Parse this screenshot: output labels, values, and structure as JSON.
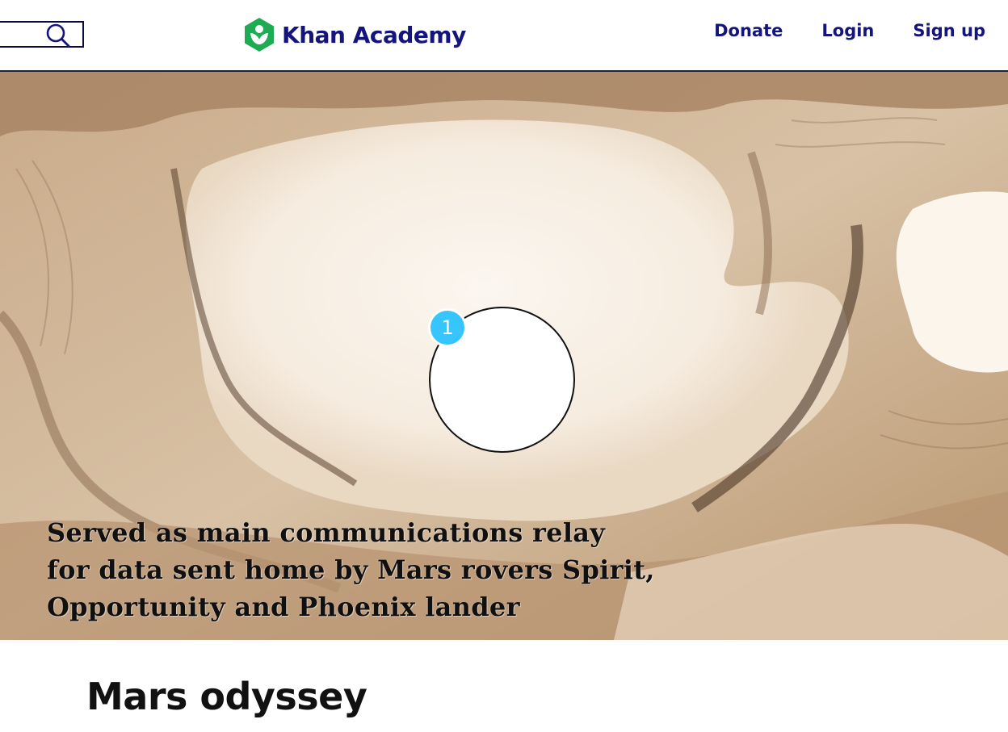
{
  "header": {
    "logo_text": "Khan Academy",
    "nav": {
      "donate": "Donate",
      "login": "Login",
      "signup": "Sign up"
    }
  },
  "video": {
    "caption_lines": [
      "Served as main communications relay",
      "for data sent home by Mars rovers Spirit,",
      "Opportunity and Phoenix lander"
    ],
    "badge": "1"
  },
  "page": {
    "title": "Mars odyssey"
  },
  "colors": {
    "brand": "#14147d",
    "logo_green": "#1fab54",
    "badge_blue": "#37c5fd"
  }
}
